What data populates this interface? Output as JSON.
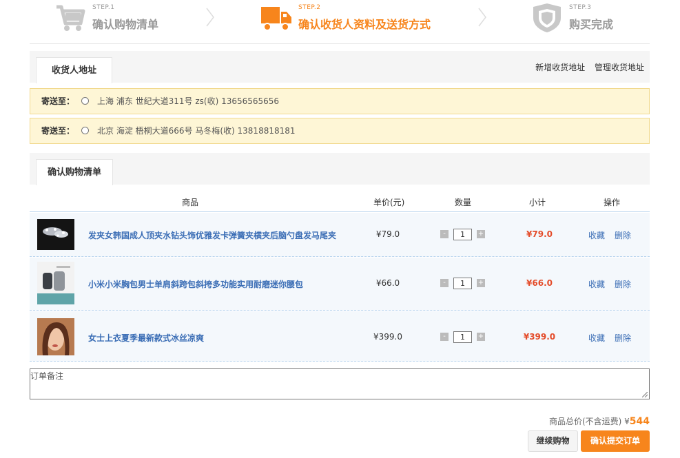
{
  "steps": [
    {
      "num": "STEP.1",
      "title": "确认购物清单",
      "icon": "cart-icon",
      "state": "done"
    },
    {
      "num": "STEP.2",
      "title": "确认收货人资料及送货方式",
      "icon": "truck-icon",
      "state": "active"
    },
    {
      "num": "STEP.3",
      "title": "购买完成",
      "icon": "shield-icon",
      "state": "todo"
    }
  ],
  "address": {
    "tab_label": "收货人地址",
    "links": [
      "新增收货地址",
      "管理收货地址"
    ],
    "ship_to_label": "寄送至：",
    "items": [
      {
        "text": "上海 浦东 世纪大道311号  zs(收)  13656565656"
      },
      {
        "text": "北京 海淀 梧桐大道666号  马冬梅(收)  13818818181"
      }
    ]
  },
  "cart": {
    "tab_label": "确认购物清单",
    "columns": {
      "product": "商品",
      "price": "单价(元)",
      "qty": "数量",
      "subtotal": "小计",
      "ops": "操作"
    },
    "rows": [
      {
        "name": "发夹女韩国成人顶夹水钻头饰优雅发卡弹簧夹横夹后脑勺盘发马尾夹",
        "price": "¥79.0",
        "qty": "1",
        "subtotal": "¥79.0"
      },
      {
        "name": "小米小米胸包男士单肩斜跨包斜挎多功能实用耐磨迷你腰包",
        "price": "¥66.0",
        "qty": "1",
        "subtotal": "¥66.0"
      },
      {
        "name": "女士上衣夏季最新款式冰丝凉爽",
        "price": "¥399.0",
        "qty": "1",
        "subtotal": "¥399.0"
      }
    ],
    "op_fav": "收藏",
    "op_del": "删除",
    "qty_minus": "-",
    "qty_plus": "+"
  },
  "remark": {
    "placeholder": "订单备注"
  },
  "summary": {
    "label": "商品总价(不含运费) ¥",
    "amount": "544"
  },
  "buttons": {
    "continue": "继续购物",
    "submit": "确认提交订单"
  },
  "colors": {
    "accent": "#f7851c",
    "link": "#3a6db5",
    "price_red": "#e44c2a",
    "address_bg": "#fef6d6"
  }
}
